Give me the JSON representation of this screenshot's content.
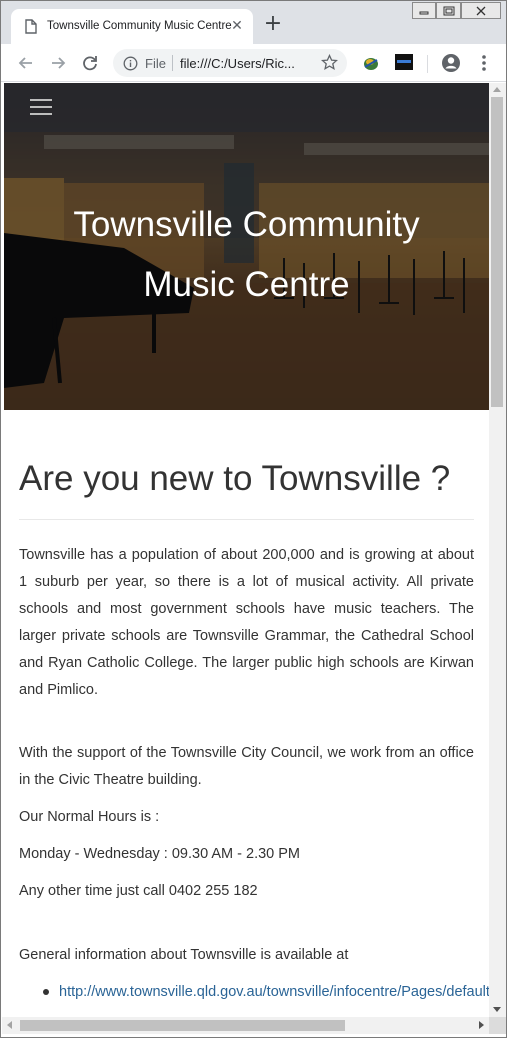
{
  "browser": {
    "tab_title": "Townsville Community Music Centre",
    "tab_close_glyph": "✕",
    "new_tab_glyph": "+",
    "scheme_label": "File",
    "url_display": "file:///C:/Users/Ric...",
    "icons": {
      "favicon": "page-icon",
      "back": "back-arrow-icon",
      "forward": "forward-arrow-icon",
      "reload": "reload-icon",
      "info": "info-icon",
      "star": "star-icon",
      "profile": "profile-icon",
      "menu": "kebab-menu-icon"
    }
  },
  "hero": {
    "title_line1": "Townsville Community",
    "title_line2": "Music Centre"
  },
  "main": {
    "heading": "Are you new to Townsville ?",
    "paragraph1": "Townsville has a population of about 200,000 and is growing at about 1 suburb per year, so there is a lot of musical activity. All private schools and most government schools have music teachers. The larger private schools are Townsville Grammar, the Cathedral School and Ryan Catholic College. The larger public high schools are Kirwan and Pimlico.",
    "paragraph2": "With the support of the Townsville City Council, we work from an office in the Civic Theatre building.",
    "hours_heading": "Our Normal Hours is :",
    "hours": "Monday - Wednesday : 09.30 AM - 2.30 PM",
    "other_time": "Any other time just call 0402 255 182",
    "info_intro": "General information about Townsville is available at",
    "links": [
      "http://www.townsville.qld.gov.au/townsville/infocentre/Pages/default"
    ]
  },
  "colors": {
    "link": "#2a6496",
    "text": "#333333",
    "hero_title": "#ffffff",
    "tabstrip": "#dee1e6"
  }
}
